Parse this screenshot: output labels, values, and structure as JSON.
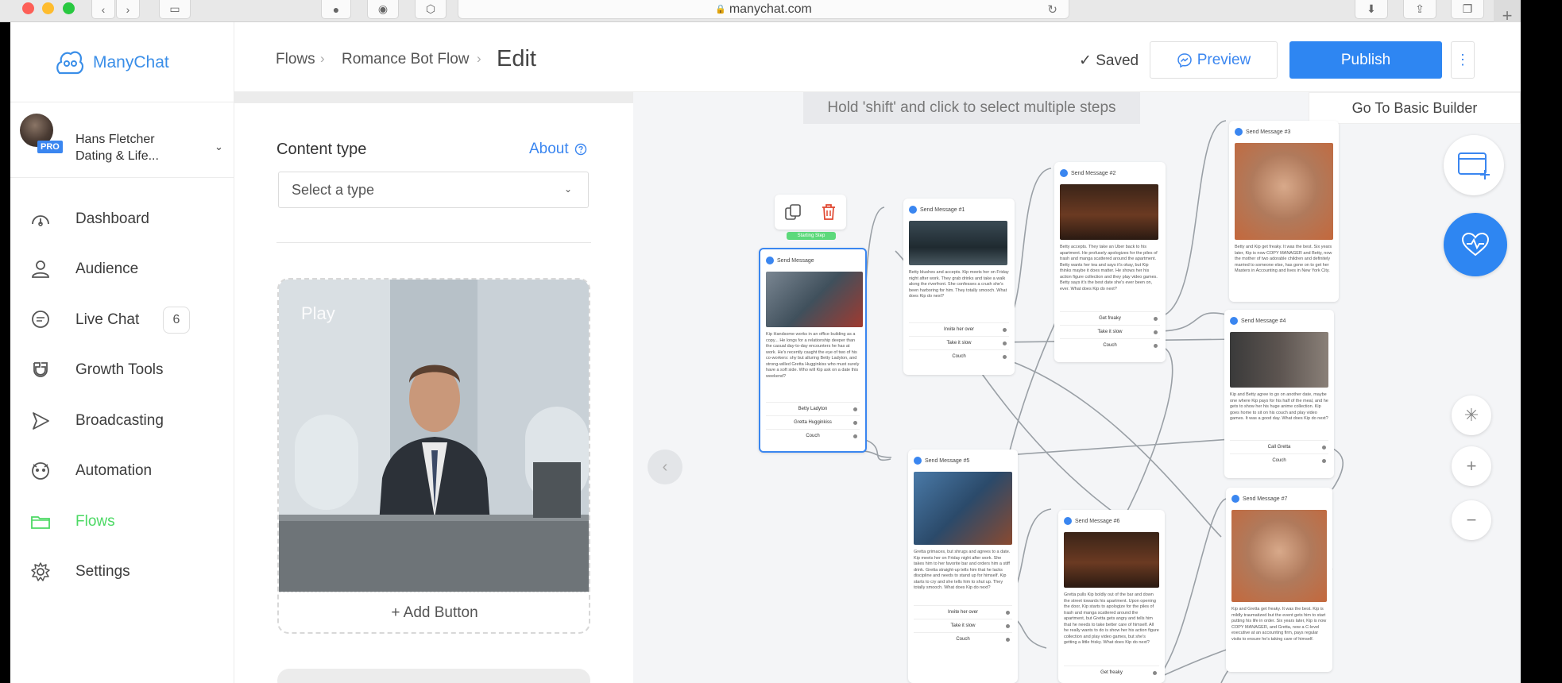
{
  "browser": {
    "url": "manychat.com"
  },
  "app": {
    "brand": "ManyChat",
    "colors": {
      "primary": "#2e86f2",
      "active": "#4cd964",
      "canvas": "#f4f5f7"
    }
  },
  "account": {
    "name": "Hans Fletcher",
    "subtitle": "Dating & Life...",
    "badge": "PRO"
  },
  "nav": {
    "items": [
      {
        "label": "Dashboard",
        "icon": "gauge-icon"
      },
      {
        "label": "Audience",
        "icon": "user-icon"
      },
      {
        "label": "Live Chat",
        "icon": "chat-icon",
        "badge": "6"
      },
      {
        "label": "Growth Tools",
        "icon": "magnet-icon"
      },
      {
        "label": "Broadcasting",
        "icon": "send-icon"
      },
      {
        "label": "Automation",
        "icon": "robot-icon"
      },
      {
        "label": "Flows",
        "icon": "folder-icon",
        "active": true
      },
      {
        "label": "Settings",
        "icon": "gear-icon"
      }
    ]
  },
  "header": {
    "breadcrumb": [
      "Flows",
      "Romance Bot Flow"
    ],
    "current": "Edit",
    "saved": "Saved",
    "preview": "Preview",
    "publish": "Publish"
  },
  "panel": {
    "content_type_label": "Content type",
    "about": "About",
    "select_placeholder": "Select a type",
    "media_play": "Play",
    "add_button": "+ Add Button"
  },
  "canvas": {
    "hint": "Hold 'shift' and click to select multiple steps",
    "basic_builder": "Go To Basic Builder",
    "start_label": "Starting Step",
    "nodes": [
      {
        "id": "n0",
        "platform": "Facebook",
        "title": "Send Message",
        "text": "Kip Handsome works in an office building as a copy... He longs for a relationship deeper than the casual day-to-day encounters he has at work. He's recently caught the eye of two of his co-workers: shy but alluring Betty Ladyton, and strong-willed Gretta Hugginkiss who must surely have a soft side. Who will Kip ask on a date this weekend?",
        "buttons": [
          "Betty Ladyton",
          "Gretta Hugginkiss",
          "Couch"
        ]
      },
      {
        "id": "n1",
        "platform": "Facebook",
        "title": "Send Message #1",
        "text": "Betty blushes and accepts. Kip meets her on Friday night after work. They grab drinks and take a walk along the riverfront. She confesses a crush she's been harboring for him. They totally smooch. What does Kip do next?",
        "buttons": [
          "Invite her over",
          "Take it slow",
          "Couch"
        ]
      },
      {
        "id": "n2",
        "platform": "Facebook",
        "title": "Send Message #2",
        "text": "Betty accepts. They take an Uber back to his apartment. He profusely apologizes for the piles of trash and manga scattered around the apartment. Betty wants her tea and says it's okay, but Kip thinks maybe it does matter. He shows her his action figure collection and they play video games. Betty says it's the best date she's ever been on, ever. What does Kip do next?",
        "buttons": [
          "Get freaky",
          "Take it slow",
          "Couch"
        ]
      },
      {
        "id": "n3",
        "platform": "Facebook",
        "title": "Send Message #3",
        "text": "Betty and Kip get freaky. It was the best. Six years later, Kip is now COPY MANAGER and Betty, now the mother of two adorable children and definitely married to someone else, has gone on to get her Masters in Accounting and lives in New York City.",
        "buttons": []
      },
      {
        "id": "n4",
        "platform": "Facebook",
        "title": "Send Message #4",
        "text": "Kip and Betty agree to go on another date, maybe one where Kip pays for his half of the meal, and he gets to show her his huge anime collection. Kip goes home to sit on his couch and play video games. It was a good day. What does Kip do next?",
        "buttons": [
          "Call Gretta",
          "Couch"
        ]
      },
      {
        "id": "n5",
        "platform": "Facebook",
        "title": "Send Message #5",
        "text": "Gretta grimaces, but shrugs and agrees to a date. Kip meets her on Friday night after work. She takes him to her favorite bar and orders him a stiff drink. Gretta straight-up tells him that he lacks discipline and needs to stand up for himself. Kip starts to cry and she tells him to shut up. They totally smooch. What does Kip do next?",
        "buttons": [
          "Invite her over",
          "Take it slow",
          "Couch"
        ]
      },
      {
        "id": "n6",
        "platform": "Facebook",
        "title": "Send Message #6",
        "text": "Gretta pulls Kip boldly out of the bar and down the street towards his apartment. Upon opening the door, Kip starts to apologize for the piles of trash and manga scattered around the apartment, but Gretta gets angry and tells him that he needs to take better care of himself. All he really wants to do is show her his action figure collection and play video games, but she's getting a little frisky. What does Kip do next?",
        "buttons": [
          "Get freaky"
        ]
      },
      {
        "id": "n7",
        "platform": "Facebook",
        "title": "Send Message #7",
        "text": "Kip and Gretta get freaky. It was the best. Kip is mildly traumatized but the event gets him to start putting his life in order. Six years later, Kip is now COPY MANAGER, and Gretta, now a C-level executive at an accounting firm, pays regular visits to ensure he's taking care of himself.",
        "buttons": []
      }
    ]
  }
}
